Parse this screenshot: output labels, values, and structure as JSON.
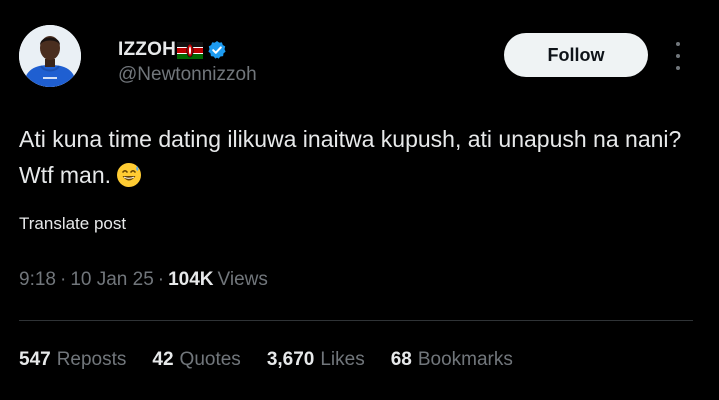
{
  "author": {
    "display_name": "IZZOH",
    "handle": "@Newtonnizzoh",
    "flag_icon": "kenya-flag-icon",
    "verified_icon": "verified-badge-icon",
    "verified_color": "#1d9bf0"
  },
  "actions": {
    "follow_label": "Follow",
    "more_icon": "more-options-icon"
  },
  "tweet": {
    "text": "Ati kuna time dating ilikuwa inaitwa kupush, ati unapush na nani? Wtf man.",
    "emoji": "grinning-sweat-emoji",
    "translate_label": "Translate post",
    "time": "9:18",
    "separator": "·",
    "date": "10 Jan 25",
    "views_count": "104K",
    "views_label": "Views"
  },
  "stats": [
    {
      "count": "547",
      "label": "Reposts"
    },
    {
      "count": "42",
      "label": "Quotes"
    },
    {
      "count": "3,670",
      "label": "Likes"
    },
    {
      "count": "68",
      "label": "Bookmarks"
    }
  ],
  "colors": {
    "background": "#000000",
    "primary_text": "#e7e9ea",
    "secondary_text": "#71767b",
    "divider": "#2f3336",
    "follow_bg": "#eff3f4"
  }
}
